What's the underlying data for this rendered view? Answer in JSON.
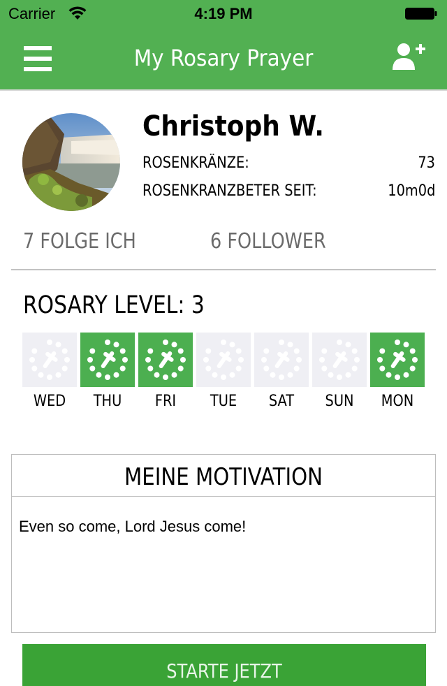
{
  "status_bar": {
    "carrier": "Carrier",
    "time": "4:19 PM",
    "wifi_icon": "wifi-icon",
    "battery_icon": "battery-full-icon"
  },
  "nav": {
    "title": "My Rosary Prayer",
    "menu_icon": "hamburger-menu-icon",
    "add_user_icon": "add-user-icon"
  },
  "colors": {
    "brand_green": "#52b052",
    "day_done": "#4caf50",
    "day_pending": "#efeff4",
    "button_green": "#3aa336"
  },
  "profile": {
    "name": "Christoph W.",
    "avatar": "waterfall-landscape-photo",
    "stats": [
      {
        "label": "ROSENKRÄNZE:",
        "value": "73"
      },
      {
        "label": "ROSENKRANZBETER SEIT:",
        "value": "10m0d"
      }
    ],
    "following": "7 FOLGE ICH",
    "followers": "6 FOLLOWER"
  },
  "rosary": {
    "level_text": "ROSARY LEVEL: 3",
    "days": [
      {
        "label": "WED",
        "done": false
      },
      {
        "label": "THU",
        "done": true
      },
      {
        "label": "FRI",
        "done": true
      },
      {
        "label": "TUE",
        "done": false
      },
      {
        "label": "SAT",
        "done": false
      },
      {
        "label": "SUN",
        "done": false
      },
      {
        "label": "MON",
        "done": true
      }
    ]
  },
  "motivation": {
    "title": "MEINE MOTIVATION",
    "text": "Even so come, Lord Jesus come!"
  },
  "start_button": {
    "label": "STARTE JETZT"
  }
}
